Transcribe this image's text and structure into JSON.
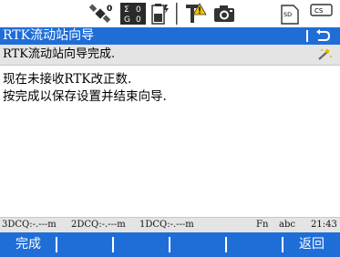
{
  "window": {
    "title": "RTK流动站向导"
  },
  "status_icons": [
    {
      "name": "satellite-icon",
      "superscript": "0"
    },
    {
      "name": "sigma-counter-icon",
      "top_value": "0",
      "bottom_value": "0",
      "top_label": "Σ",
      "bottom_label": "G"
    },
    {
      "name": "battery-icon"
    },
    {
      "name": "antenna-warning-icon"
    },
    {
      "name": "camera-icon"
    },
    {
      "name": "sd-card-icon",
      "label": "SD"
    },
    {
      "name": "cs-controller-icon",
      "label": "CS"
    }
  ],
  "subheader": {
    "text": "RTK流动站向导完成."
  },
  "content": {
    "line1": "现在未接收RTK改正数.",
    "line2": "按完成以保存设置并结束向导."
  },
  "infobar": {
    "dcq3": "3DCQ:-.---m",
    "dcq2": "2DCQ:-.---m",
    "dcq1": "1DCQ:-.---m",
    "fn": "Fn",
    "input_mode": "abc",
    "time": "21:43"
  },
  "fkeys": {
    "f1": "完成",
    "f2": "",
    "f3": "",
    "f4": "",
    "f5": "",
    "f6": "返回"
  },
  "colors": {
    "accent_blue": "#1f6ed8",
    "bar_gray": "#e4e4e4"
  }
}
